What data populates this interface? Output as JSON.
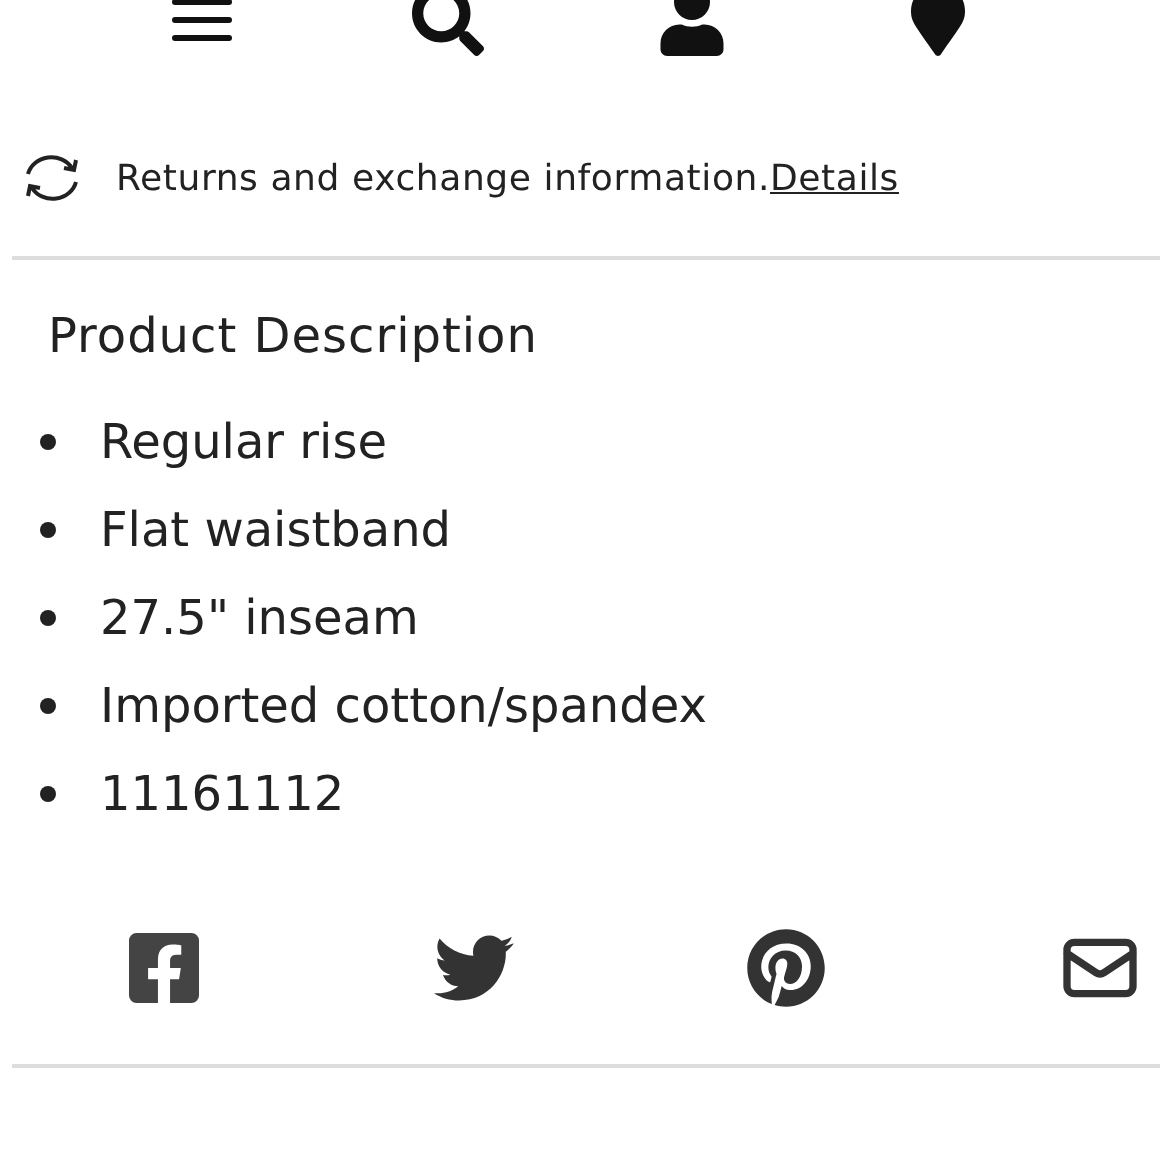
{
  "returns": {
    "text": "Returns and exchange information.",
    "link": "Details"
  },
  "description": {
    "title": "Product Description",
    "bullets": [
      "Regular rise",
      "Flat waistband",
      "27.5\" inseam",
      "Imported cotton/spandex",
      "11161112"
    ]
  }
}
